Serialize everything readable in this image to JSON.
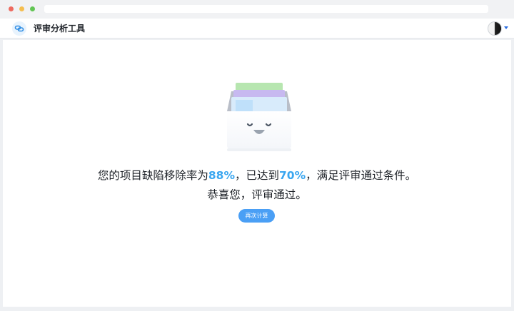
{
  "app": {
    "title": "评审分析工具"
  },
  "result": {
    "prefix": "您的项目缺陷移除率为",
    "rate": "88%",
    "middle": "，已达到",
    "threshold": "70%",
    "suffix": "，满足评审通过条件。",
    "congrats": "恭喜您，评审通过。"
  },
  "actions": {
    "recalculate_label": "再次计算"
  },
  "colors": {
    "accent": "#3aa6f0",
    "button": "#4a9ff5"
  }
}
